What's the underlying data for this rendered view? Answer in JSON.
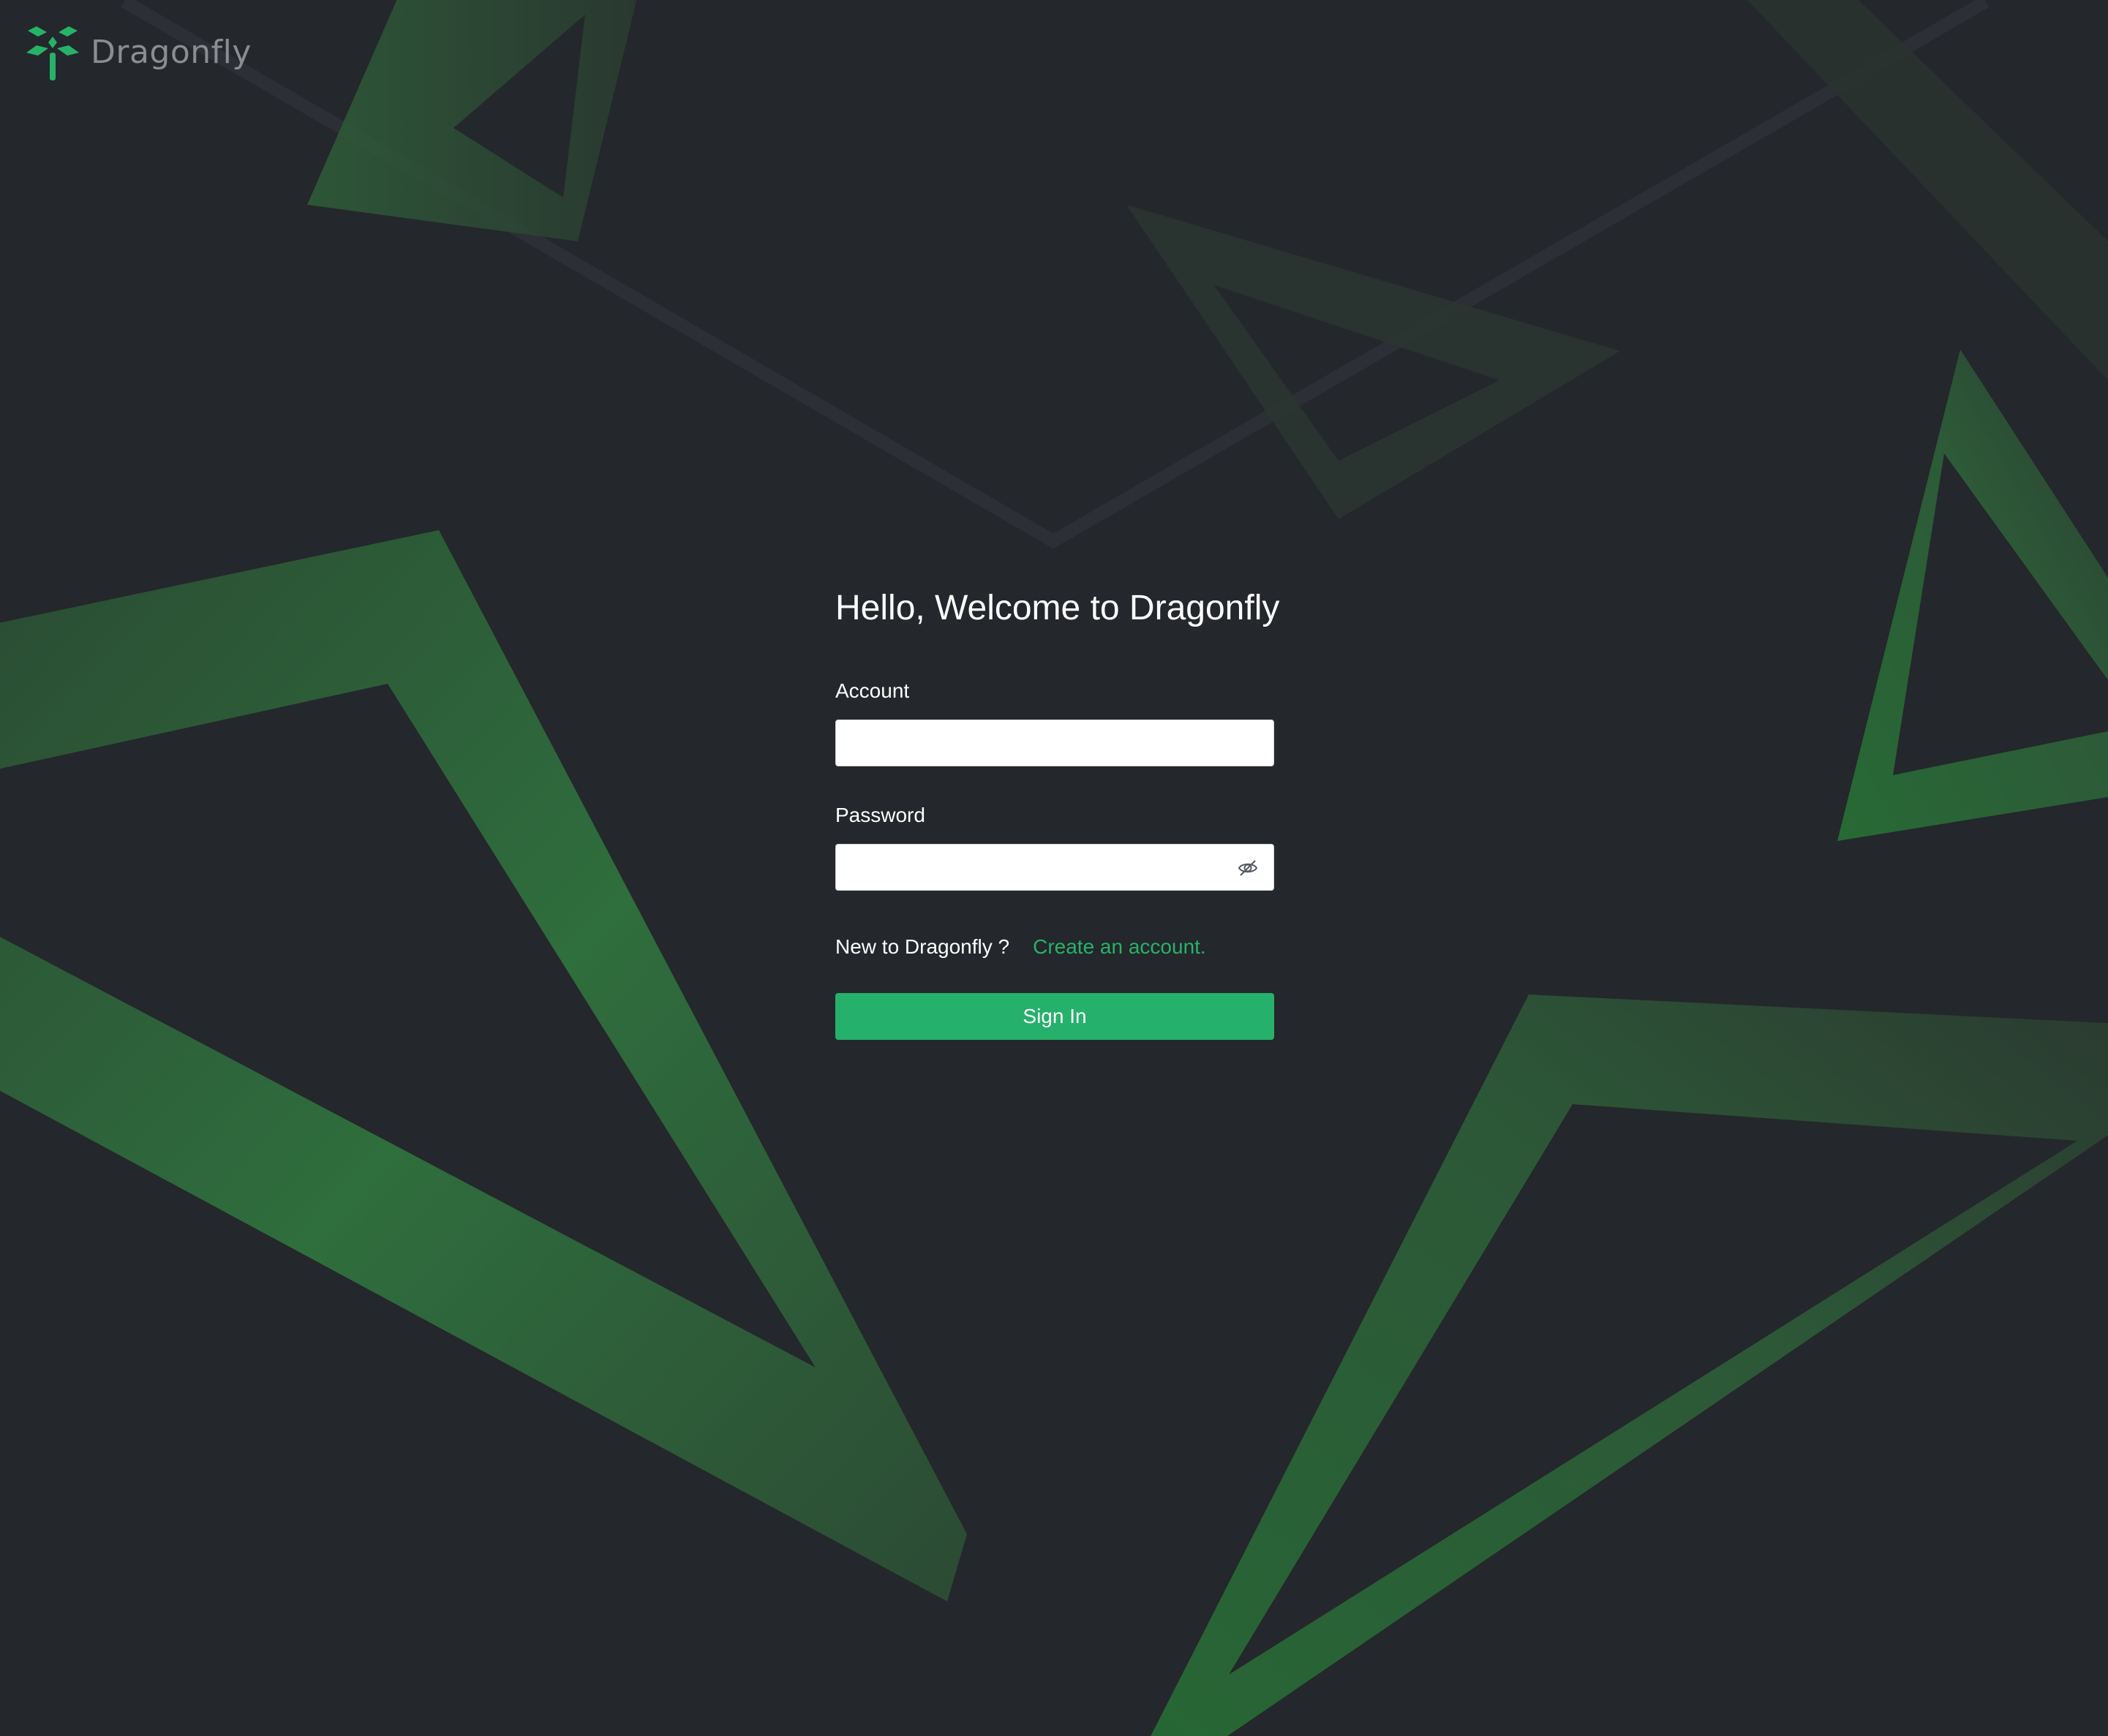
{
  "brand": {
    "name": "Dragonfly",
    "logo_icon": "dragonfly-logo-icon",
    "accent_color": "#25b16b"
  },
  "login": {
    "title": "Hello, Welcome to Dragonfly",
    "account_label": "Account",
    "account_value": "",
    "password_label": "Password",
    "password_value": "",
    "password_toggle_icon": "eye-slash-icon",
    "signup_prompt": "New to Dragonfly ?",
    "signup_link": "Create an account.",
    "signin_button": "Sign In"
  },
  "theme": {
    "background": "#24272b",
    "link_color": "#27b26a"
  }
}
